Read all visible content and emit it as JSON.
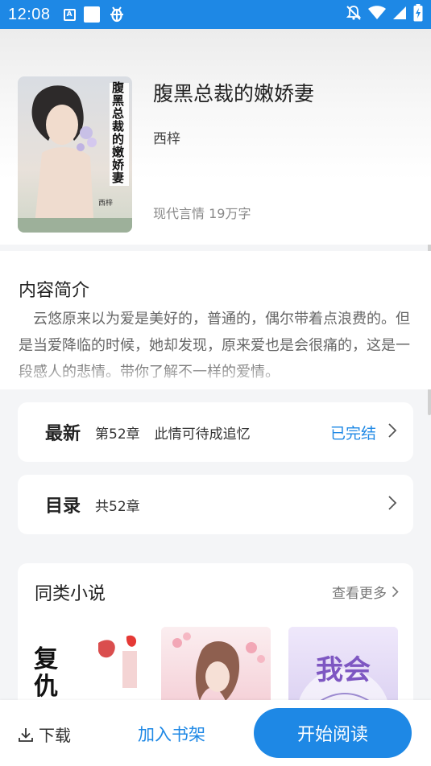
{
  "status_bar": {
    "time": "12:08",
    "icons": [
      "a-notification-icon",
      "white-square-icon",
      "bug-icon",
      "mute-bell-icon",
      "wifi-icon",
      "signal-icon",
      "battery-charging-icon"
    ]
  },
  "book": {
    "title": "腹黑总裁的嫩娇妻",
    "author": "西梓",
    "meta": "现代言情 19万字",
    "cover_title_vertical": "腹黑总裁的嫩娇妻",
    "cover_author": "西梓"
  },
  "intro": {
    "heading": "内容简介",
    "text": "云悠原来以为爱是美好的，普通的，偶尔带着点浪费的。但是当爱降临的时候，她却发现，原来爱也是会很痛的，这是一段感人的悲情。带你了解不一样的爱情。"
  },
  "latest": {
    "label": "最新",
    "chapter": "第52章",
    "chapter_title": "此情可待成追忆",
    "status": "已完结"
  },
  "catalog": {
    "label": "目录",
    "count": "共52章"
  },
  "similar": {
    "heading": "同类小说",
    "see_more": "查看更多",
    "items": [
      {
        "cover_text": "复仇的",
        "accent": "#c62828"
      },
      {
        "cover_text": "",
        "accent": "#f3c6cf"
      },
      {
        "cover_text": "我会",
        "accent": "#7e57c2"
      }
    ]
  },
  "bottom_bar": {
    "download": "下载",
    "add_shelf": "加入书架",
    "start_read": "开始阅读"
  },
  "colors": {
    "accent": "#1e88e5",
    "status_bar": "#1e88e5"
  }
}
